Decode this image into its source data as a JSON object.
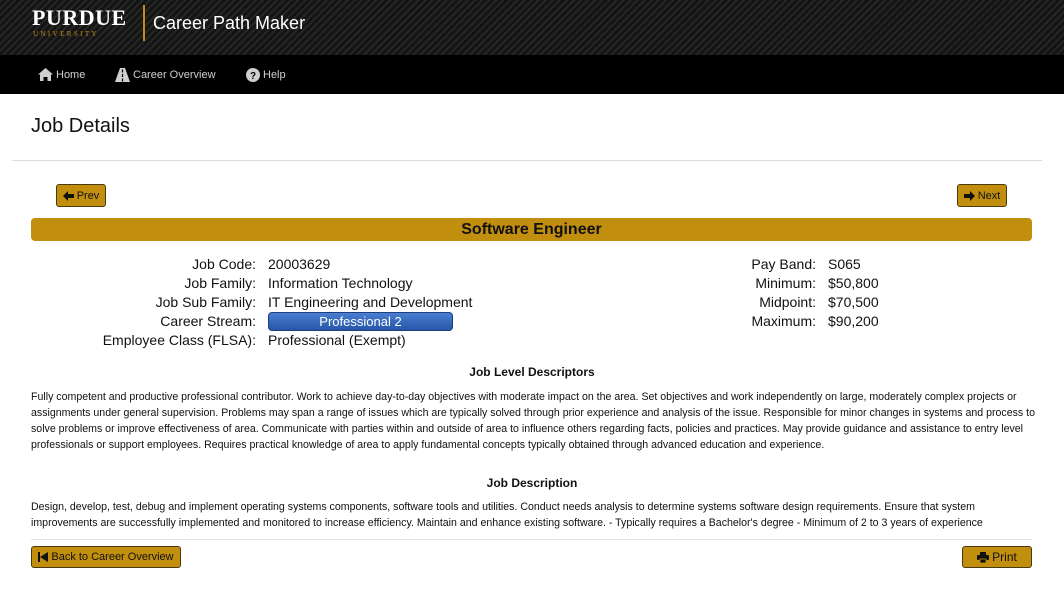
{
  "header": {
    "logo_word": "PURDUE",
    "logo_sub": "UNIVERSITY",
    "app_title": "Career Path Maker"
  },
  "nav": {
    "home": "Home",
    "career_overview": "Career Overview",
    "help": "Help"
  },
  "page": {
    "title": "Job Details",
    "prev_label": "Prev",
    "next_label": "Next",
    "job_title": "Software Engineer"
  },
  "details_left": [
    {
      "label": "Job Code:",
      "value": "20003629"
    },
    {
      "label": "Job Family:",
      "value": "Information Technology"
    },
    {
      "label": "Job Sub Family:",
      "value": "IT Engineering and Development"
    },
    {
      "label": "Career Stream:",
      "value": "Professional 2"
    },
    {
      "label": "Employee Class (FLSA):",
      "value": "Professional (Exempt)"
    }
  ],
  "details_right": [
    {
      "label": "Pay Band:",
      "value": "S065"
    },
    {
      "label": "Minimum:",
      "value": "$50,800"
    },
    {
      "label": "Midpoint:",
      "value": "$70,500"
    },
    {
      "label": "Maximum:",
      "value": "$90,200"
    }
  ],
  "descriptors": {
    "heading": "Job Level Descriptors",
    "text": "Fully competent and productive professional contributor. Work to achieve day-to-day objectives with moderate impact on the area. Set objectives and work independently on large, moderately complex projects or assignments under general supervision. Problems may span a range of issues which are typically solved through prior experience and analysis of the issue. Responsible for minor changes in systems and process to solve problems or improve effectiveness of area. Communicate with parties within and outside of area to influence others regarding facts, policies and practices. May provide guidance and assistance to entry level professionals or support employees. Requires practical knowledge of area to apply fundamental concepts typically obtained through advanced education and experience."
  },
  "description": {
    "heading": "Job Description",
    "text": "Design, develop, test, debug and implement operating systems components, software tools and utilities. Conduct needs analysis to determine systems software design requirements. Ensure that system improvements are successfully implemented and monitored to increase efficiency. Maintain and enhance existing software. - Typically requires a Bachelor's degree - Minimum of 2 to 3 years of experience"
  },
  "footer": {
    "back_label": "Back to Career Overview",
    "print_label": "Print"
  },
  "colors": {
    "gold": "#c28e0e",
    "header_bg": "#1a1a1a",
    "nav_bg": "#000000",
    "stream_blue": "#2f63b8"
  }
}
